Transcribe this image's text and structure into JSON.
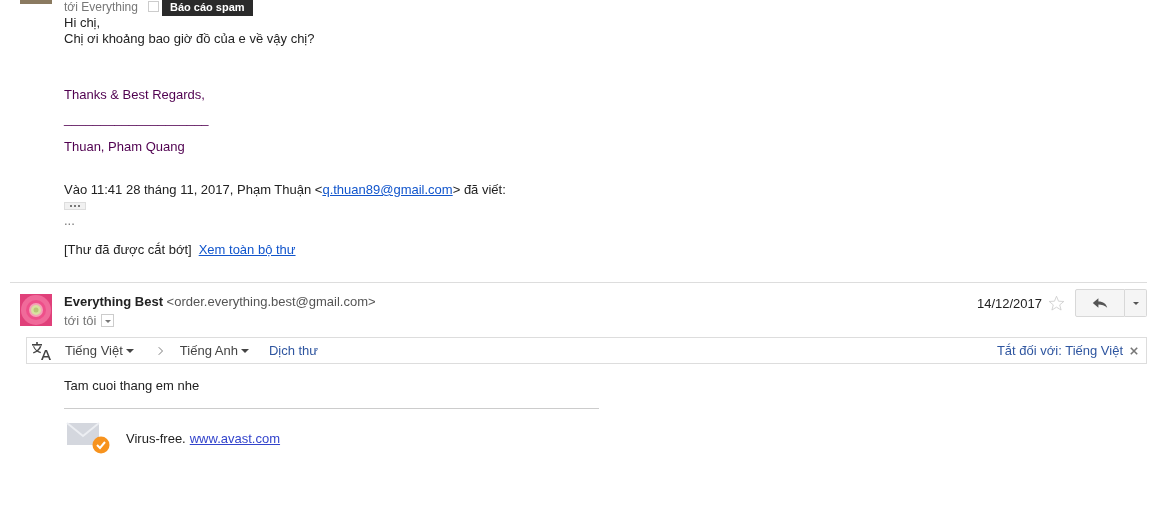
{
  "previous_message": {
    "recipient_line": "tới Everything",
    "tooltip": "Báo cáo spam",
    "body": [
      "Hi chị,",
      "Chị ơi khoảng bao giờ đồ của e về vậy chị?"
    ],
    "signature": [
      "Thanks & Best Regards,",
      "____________________",
      "Thuan, Pham Quang"
    ],
    "quote_header": {
      "before": "Vào 11:41 28 tháng 11, 2017, Phạm Thuận <",
      "email": "q.thuan89@gmail.com",
      "after": "> đã viết:"
    },
    "quote_ellipsis": "...",
    "truncated_note": "[Thư đã được cắt bớt]",
    "view_full_link": "Xem toàn bộ thư"
  },
  "message": {
    "sender_name": "Everything Best",
    "sender_email": "<order.everything.best@gmail.com>",
    "recipient": "tới tôi",
    "date": "14/12/2017",
    "starred": false,
    "translate_bar": {
      "source_language": "Tiếng Việt",
      "target_language": "Tiếng Anh",
      "translate_link": "Dịch thư",
      "turn_off_link": "Tắt đối với: Tiếng Việt"
    },
    "body": "Tam cuoi thang em nhe",
    "footer": {
      "text": "Virus-free.",
      "link": "www.avast.com"
    }
  }
}
